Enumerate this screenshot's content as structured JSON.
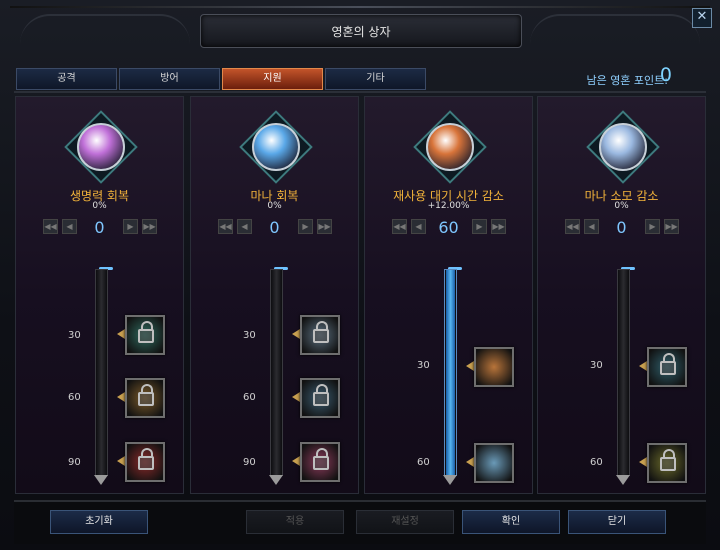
{
  "window": {
    "title": "영혼의 상자",
    "close_label": "✕"
  },
  "tabs": [
    {
      "label": "공격",
      "active": false
    },
    {
      "label": "방어",
      "active": false
    },
    {
      "label": "지원",
      "active": true
    },
    {
      "label": "기타",
      "active": false
    }
  ],
  "points": {
    "label": "남은 영혼 포인트:",
    "value": "0"
  },
  "skills": [
    {
      "name": "생명력 회복",
      "percent": "0%",
      "value": "0",
      "fill_fraction": 0,
      "levels": [
        "30",
        "60",
        "90"
      ],
      "orb_color": "#c070d8",
      "node_colors": [
        "#2f6a5e",
        "#7a5a2a",
        "#8a2a2a"
      ]
    },
    {
      "name": "마나 회복",
      "percent": "0%",
      "value": "0",
      "fill_fraction": 0,
      "levels": [
        "30",
        "60",
        "90"
      ],
      "orb_color": "#5aa8e8",
      "node_colors": [
        "#5a6e7e",
        "#3a5a6e",
        "#8a3a5a"
      ]
    },
    {
      "name": "재사용 대기 시간 감소",
      "percent": "+12.00%",
      "value": "60",
      "fill_fraction": 1,
      "levels": [
        "30",
        "60"
      ],
      "orb_color": "#d8743a",
      "node_colors": [
        "#b8743a",
        "#6a9ab8"
      ]
    },
    {
      "name": "마나 소모 감소",
      "percent": "0%",
      "value": "0",
      "fill_fraction": 0,
      "levels": [
        "30",
        "60"
      ],
      "orb_color": "#9ab8e0",
      "node_colors": [
        "#2f5e6a",
        "#6a6a2a"
      ]
    }
  ],
  "controls": {
    "first": "◀◀",
    "prev": "◀",
    "next": "▶",
    "last": "▶▶"
  },
  "buttons": {
    "reset": "초기화",
    "apply": "적용",
    "reassign": "재설정",
    "confirm": "확인",
    "close": "닫기"
  },
  "colors": {
    "accent_gold": "#f2b33a",
    "accent_blue": "#7fc7ff",
    "active_tab": "#c3542a"
  }
}
